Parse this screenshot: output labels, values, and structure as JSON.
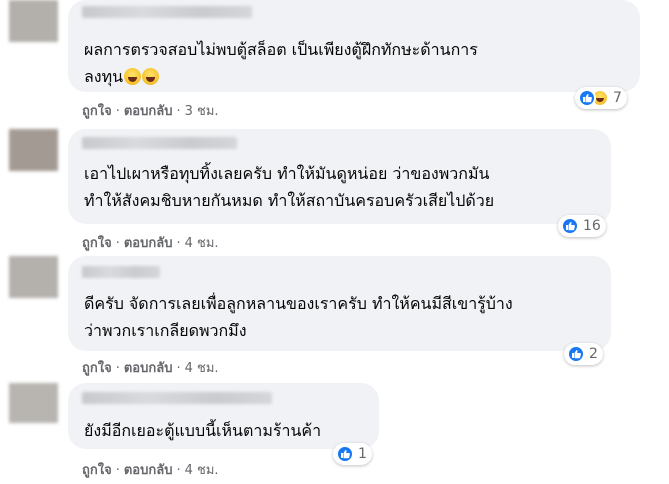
{
  "comments": [
    {
      "lines": [
        "ผลการตรวจสอบไม่พบตู้สล็อต เป็นเพียงตู้ฝึกทักษะด้านการ",
        "ลงทุน"
      ],
      "emoji": [
        "laughing-face-emoji",
        "laughing-face-emoji"
      ],
      "actions": {
        "like": "ถูกใจ",
        "reply": "ตอบกลับ",
        "time": "3 ชม."
      },
      "reactions": {
        "icons": [
          "like",
          "haha"
        ],
        "count": "7"
      }
    },
    {
      "lines": [
        "เอาไปเผาหรือทุบทิ้งเลยครับ ทำให้มันดูหน่อย ว่าของพวกมัน",
        "ทำให้สังคมชิบหายกันหมด ทำให้สถาบันครอบครัวเสียไปด้วย"
      ],
      "actions": {
        "like": "ถูกใจ",
        "reply": "ตอบกลับ",
        "time": "4 ชม."
      },
      "reactions": {
        "icons": [
          "like"
        ],
        "count": "16"
      }
    },
    {
      "lines": [
        "ดีครับ จัดการเลยเพื่อลูกหลานของเราครับ ทำให้คนมีสีเขารู้บ้าง",
        "ว่าพวกเราเกลียดพวกมึง"
      ],
      "actions": {
        "like": "ถูกใจ",
        "reply": "ตอบกลับ",
        "time": "4 ชม."
      },
      "reactions": {
        "icons": [
          "like"
        ],
        "count": "2"
      }
    },
    {
      "lines": [
        "ยังมีอีกเยอะตู้แบบนี้เห็นตามร้านค้า"
      ],
      "actions": {
        "like": "ถูกใจ",
        "reply": "ตอบกลับ",
        "time": "4 ชม."
      },
      "reactions": {
        "icons": [
          "like"
        ],
        "count": "1"
      }
    }
  ],
  "colors": {
    "bubble": "#f0f2f5",
    "secondary_text": "#65676b",
    "like_blue": "#1877f2"
  }
}
